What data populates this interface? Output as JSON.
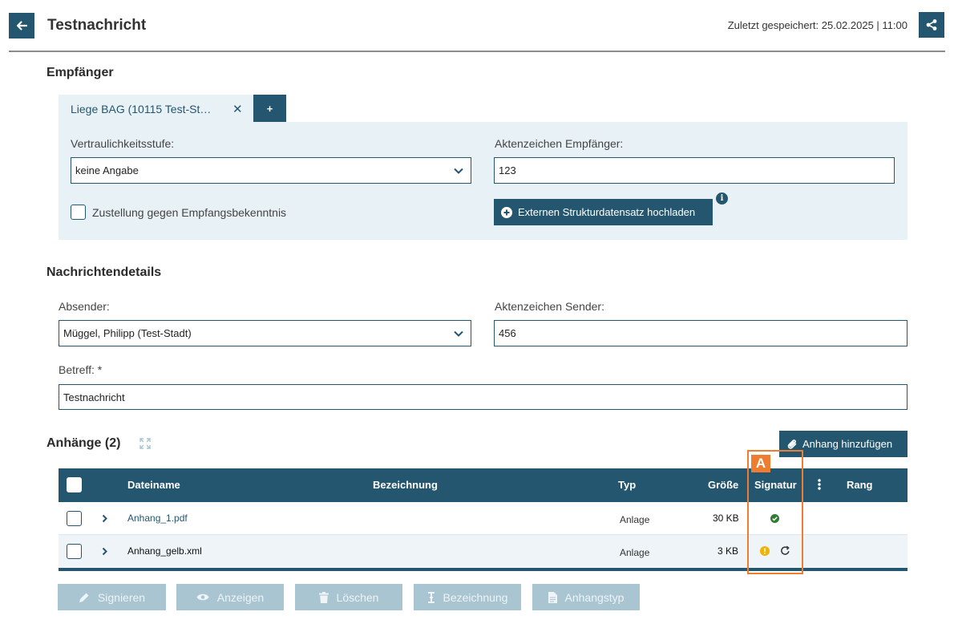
{
  "header": {
    "title": "Testnachricht",
    "last_saved": "Zuletzt gespeichert: 25.02.2025 | 11:00"
  },
  "recipients": {
    "section_title": "Empfänger",
    "tab_label": "Liege BAG (10115 Test-St…",
    "add_label": "+",
    "confidentiality_label": "Vertraulichkeitsstufe:",
    "confidentiality_value": "keine Angabe",
    "file_ref_label": "Aktenzeichen Empfänger:",
    "file_ref_value": "123",
    "delivery_checkbox_label": "Zustellung gegen Empfangsbekenntnis",
    "upload_button_label": "Externen Strukturdatensatz hochladen"
  },
  "details": {
    "section_title": "Nachrichtendetails",
    "sender_label": "Absender:",
    "sender_value": "Müggel, Philipp (Test-Stadt)",
    "sender_ref_label": "Aktenzeichen Sender:",
    "sender_ref_value": "456",
    "subject_label": "Betreff: *",
    "subject_value": "Testnachricht"
  },
  "attachments": {
    "section_title": "Anhänge (2)",
    "add_button_label": "Anhang hinzufügen",
    "columns": {
      "filename": "Dateiname",
      "designation": "Bezeichnung",
      "type": "Typ",
      "size": "Größe",
      "signature": "Signatur",
      "rank": "Rang"
    },
    "rows": [
      {
        "filename": "Anhang_1.pdf",
        "type": "Anlage",
        "size": "30 KB",
        "signature": "valid"
      },
      {
        "filename": "Anhang_gelb.xml",
        "type": "Anlage",
        "size": "3 KB",
        "signature": "warning"
      }
    ]
  },
  "actions": {
    "sign": "Signieren",
    "view": "Anzeigen",
    "delete": "Löschen",
    "designation": "Bezeichnung",
    "attachment_type": "Anhangstyp"
  },
  "annotation": {
    "tag": "A"
  },
  "colors": {
    "primary": "#24576f",
    "panel": "#e8f1f5",
    "disabled": "#a9c5d2",
    "success": "#2e7d32",
    "warning": "#f0b400",
    "annotation": "#ed7d31"
  }
}
